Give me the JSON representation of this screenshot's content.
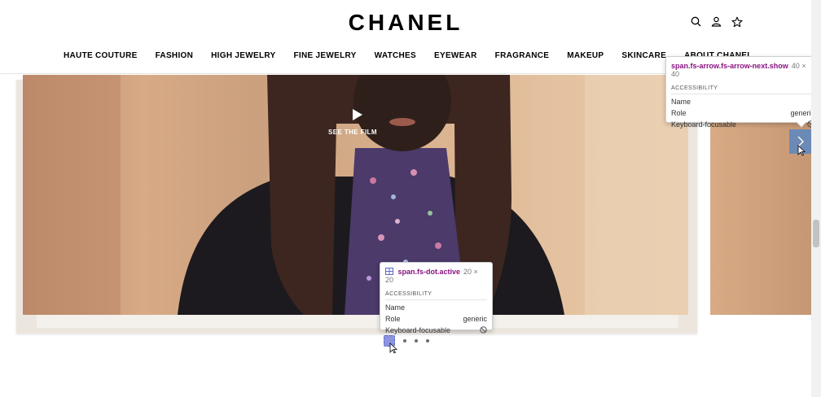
{
  "brand": {
    "name": "CHANEL"
  },
  "header": {
    "icons": [
      "search-icon",
      "account-icon",
      "wishlist-icon"
    ]
  },
  "nav": {
    "items": [
      "HAUTE COUTURE",
      "FASHION",
      "HIGH JEWELRY",
      "FINE JEWELRY",
      "WATCHES",
      "EYEWEAR",
      "FRAGRANCE",
      "MAKEUP",
      "SKINCARE",
      "ABOUT CHANEL"
    ]
  },
  "hero": {
    "film_label": "SEE THE FILM"
  },
  "carousel": {
    "dot_count": 4,
    "active_index": 0
  },
  "tooltip_arrow": {
    "selector": "span.fs-arrow.fs-arrow-next.show",
    "size": "40 × 40",
    "section": "ACCESSIBILITY",
    "name_label": "Name",
    "name_value": "",
    "role_label": "Role",
    "role_value": "generic",
    "focusable_label": "Keyboard-focusable"
  },
  "tooltip_dot": {
    "selector": "span.fs-dot.active",
    "size": "20 × 20",
    "section": "ACCESSIBILITY",
    "name_label": "Name",
    "name_value": "",
    "role_label": "Role",
    "role_value": "generic",
    "focusable_label": "Keyboard-focusable"
  },
  "colors": {
    "arrow_highlight": "#6188be",
    "dot_highlight": "#8a94e0",
    "selector_text": "#881280"
  }
}
